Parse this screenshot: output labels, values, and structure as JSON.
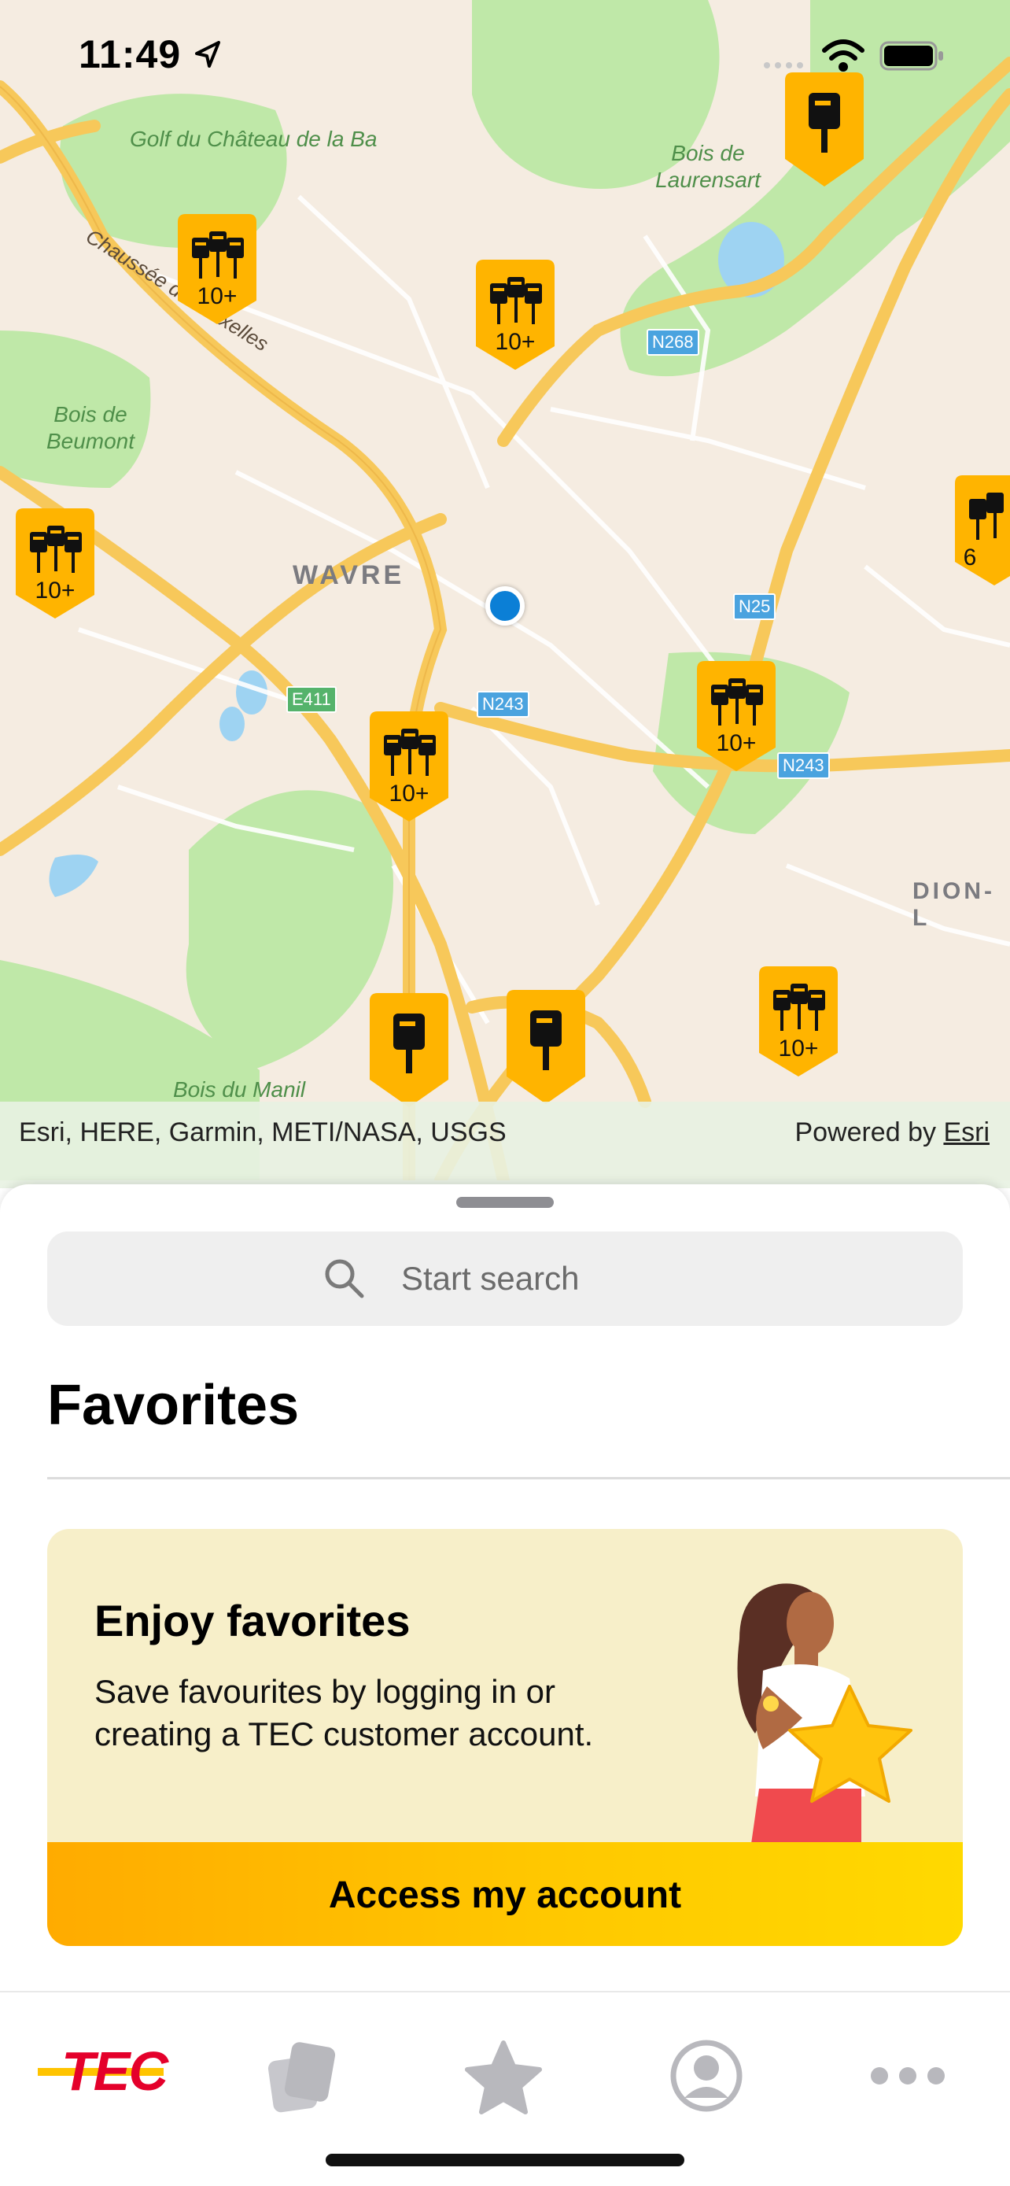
{
  "status_bar": {
    "time": "11:49"
  },
  "map": {
    "place_labels": [
      "Golf du Château de la Ba",
      "Bois de Laurensart",
      "Bois de Beumont",
      "Bois du Manil"
    ],
    "road_labels": [
      "Chaussée de Bruxelles"
    ],
    "city_labels": [
      "WAVRE",
      "DION-L"
    ],
    "road_shields": [
      "N268",
      "N25",
      "N243",
      "E411",
      "N243"
    ],
    "stop_clusters": [
      "10+",
      "10+",
      "10+",
      "6",
      "10+",
      "10+",
      "10+"
    ],
    "colors": {
      "pin": "#ffb400",
      "pin_dark": "#f29a00",
      "water": "#9ed3f2",
      "park": "#bfe8a8",
      "road": "#f7c85a"
    }
  },
  "attribution": {
    "left": "Esri, HERE, Garmin, METI/NASA, USGS",
    "right_prefix": "Powered by ",
    "right_link": "Esri"
  },
  "sheet": {
    "search_placeholder": "Start search",
    "favorites_title": "Favorites",
    "promo": {
      "title": "Enjoy favorites",
      "body": "Save favourites by logging in or creating a TEC customer account.",
      "button": "Access my account"
    }
  },
  "tab_bar": {
    "logo": "TEC",
    "tabs": [
      "home-tab",
      "tickets-tab",
      "favorites-tab",
      "account-tab",
      "more-tab"
    ]
  }
}
